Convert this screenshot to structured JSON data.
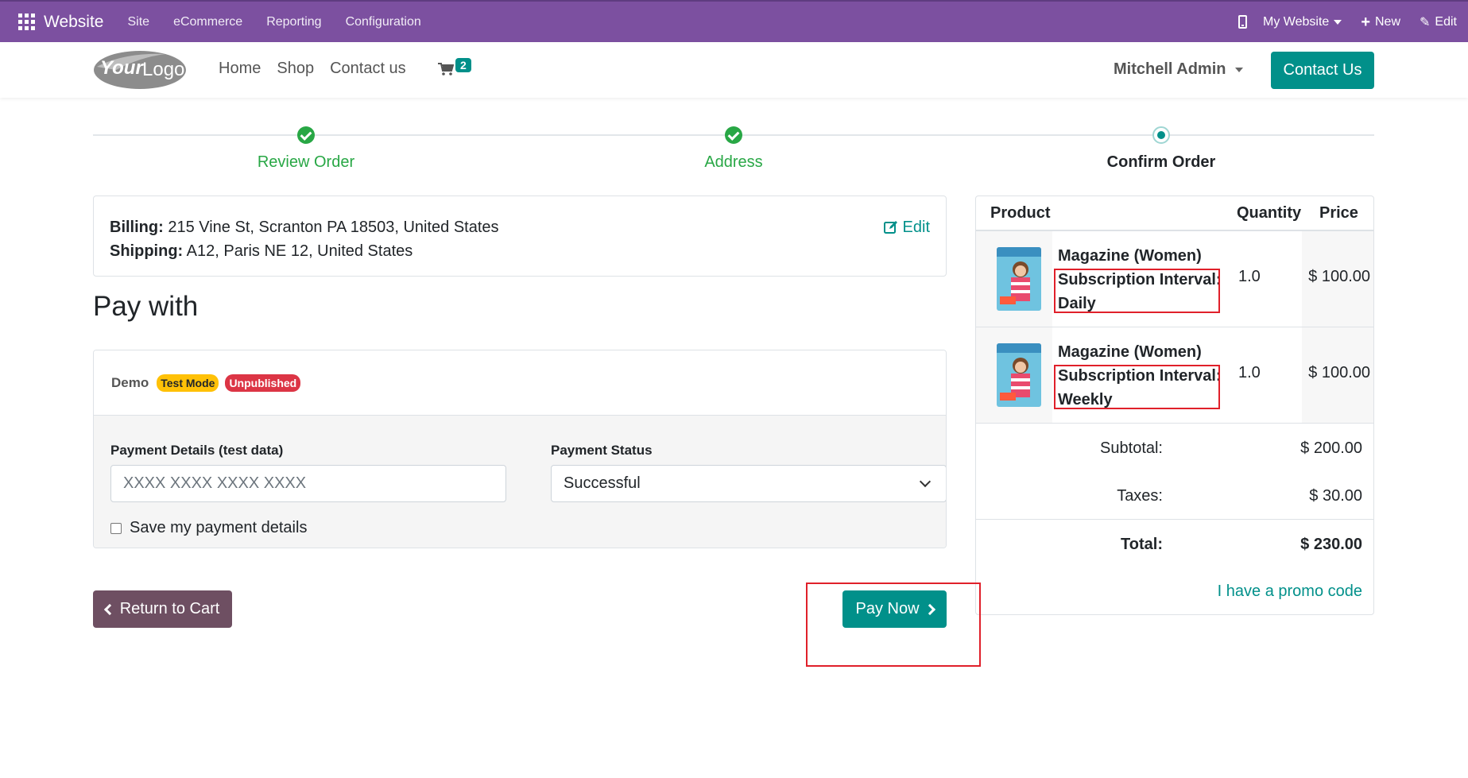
{
  "admin_bar": {
    "app_name": "Website",
    "menu": [
      "Site",
      "eCommerce",
      "Reporting",
      "Configuration"
    ],
    "website_selector": "My Website",
    "new_label": "New",
    "edit_label": "Edit"
  },
  "header": {
    "logo_text": "YourLogo",
    "nav": [
      "Home",
      "Shop",
      "Contact us"
    ],
    "cart_count": "2",
    "user": "Mitchell Admin",
    "contact_button": "Contact Us"
  },
  "wizard": {
    "steps": [
      {
        "label": "Review Order",
        "state": "done"
      },
      {
        "label": "Address",
        "state": "done"
      },
      {
        "label": "Confirm Order",
        "state": "current"
      }
    ]
  },
  "address": {
    "billing_label": "Billing:",
    "billing_value": "215 Vine St, Scranton PA 18503, United States",
    "shipping_label": "Shipping:",
    "shipping_value": "A12, Paris NE 12, United States",
    "edit_label": "Edit"
  },
  "pay_with_title": "Pay with",
  "payment": {
    "provider": "Demo",
    "badges": [
      "Test Mode",
      "Unpublished"
    ],
    "details_label": "Payment Details (test data)",
    "details_placeholder": "XXXX XXXX XXXX XXXX",
    "status_label": "Payment Status",
    "status_value": "Successful",
    "save_label": "Save my payment details"
  },
  "buttons": {
    "return_to_cart": "Return to Cart",
    "pay_now": "Pay Now"
  },
  "summary": {
    "headers": {
      "product": "Product",
      "quantity": "Quantity",
      "price": "Price"
    },
    "items": [
      {
        "name": "Magazine (Women)",
        "variant": "Subscription Interval: Daily",
        "quantity": "1.0",
        "price": "$ 100.00"
      },
      {
        "name": "Magazine (Women)",
        "variant": "Subscription Interval: Weekly",
        "quantity": "1.0",
        "price": "$ 100.00"
      }
    ],
    "subtotal_label": "Subtotal:",
    "subtotal_value": "$ 200.00",
    "taxes_label": "Taxes:",
    "taxes_value": "$ 30.00",
    "total_label": "Total:",
    "total_value": "$ 230.00",
    "promo_link": "I have a promo code"
  },
  "colors": {
    "admin_bar": "#7c50a0",
    "primary": "#01908a",
    "success": "#28a745",
    "secondary_btn": "#6e4f62",
    "highlight": "#e0202a"
  }
}
